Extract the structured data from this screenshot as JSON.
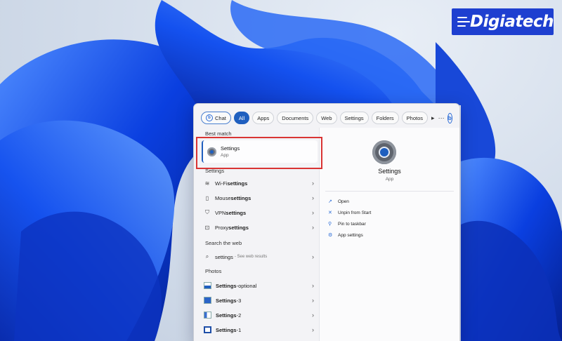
{
  "logo": {
    "text": "Digiatech"
  },
  "filters": {
    "chat": "Chat",
    "tabs": [
      "All",
      "Apps",
      "Documents",
      "Web",
      "Settings",
      "Folders",
      "Photos"
    ],
    "more": "▸",
    "ellipsis": "···",
    "bing": "b"
  },
  "best_match": {
    "header": "Best match",
    "title": "Settings",
    "subtitle": "App"
  },
  "settings_section": {
    "header": "Settings",
    "items": [
      {
        "pre": "Wi-Fi ",
        "bold": "settings",
        "icon": "wifi-icon"
      },
      {
        "pre": "Mouse ",
        "bold": "settings",
        "icon": "mouse-icon"
      },
      {
        "pre": "VPN ",
        "bold": "settings",
        "icon": "shield-icon"
      },
      {
        "pre": "Proxy ",
        "bold": "settings",
        "icon": "proxy-icon"
      }
    ]
  },
  "web_section": {
    "header": "Search the web",
    "query": "settings",
    "suffix": "- See web results"
  },
  "photos_section": {
    "header": "Photos",
    "items": [
      {
        "bold": "Settings",
        "rest": "-optional"
      },
      {
        "bold": "Settings",
        "rest": "-3"
      },
      {
        "bold": "Settings",
        "rest": "-2"
      },
      {
        "bold": "Settings",
        "rest": "-1"
      }
    ]
  },
  "preview": {
    "title": "Settings",
    "subtitle": "App",
    "actions": [
      {
        "label": "Open",
        "icon": "open-external-icon"
      },
      {
        "label": "Unpin from Start",
        "icon": "unpin-icon"
      },
      {
        "label": "Pin to taskbar",
        "icon": "pin-icon"
      },
      {
        "label": "App settings",
        "icon": "gear-icon"
      }
    ]
  },
  "colors": {
    "accent": "#1f5fbf",
    "highlight_box": "#d93434",
    "logo_bg": "#1e3fd0"
  }
}
